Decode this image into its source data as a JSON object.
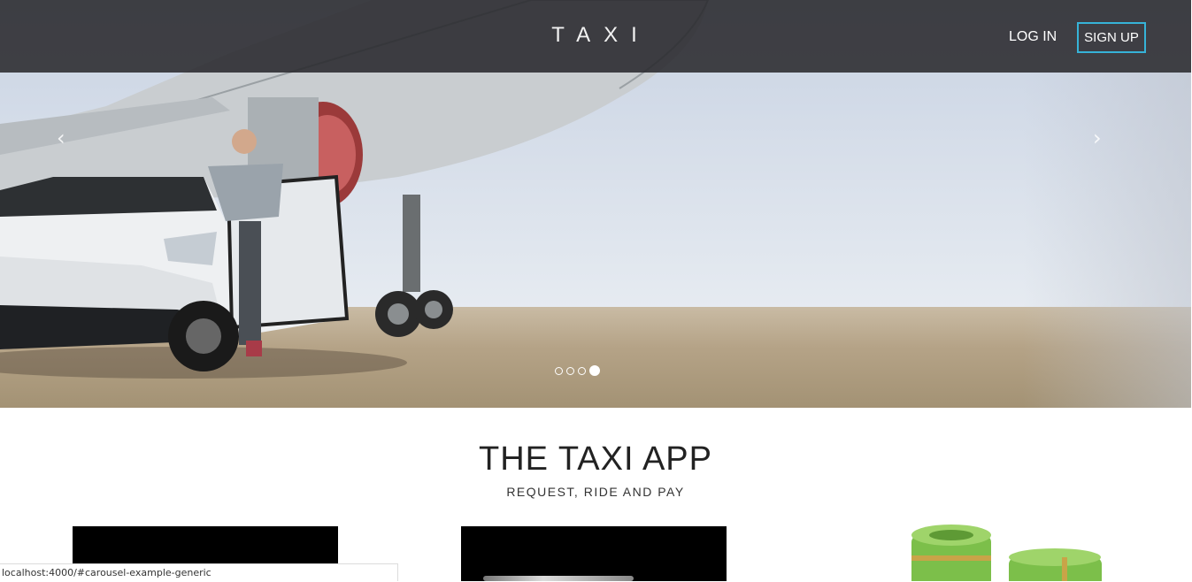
{
  "navbar": {
    "brand": "TAXI",
    "login": "LOG IN",
    "signup": "SIGN UP"
  },
  "carousel": {
    "prev_icon": "chevron-left-icon",
    "next_icon": "chevron-right-icon",
    "prev_glyph": "‹",
    "next_glyph": "›",
    "slide_count": 4,
    "active_slide": 4
  },
  "main": {
    "title": "THE TAXI APP",
    "subtitle": "REQUEST, RIDE AND PAY"
  },
  "statusbar": {
    "url": "localhost:4000/#carousel-example-generic"
  },
  "colors": {
    "navbar_bg": "#28282c",
    "signup_border": "#36b3d8"
  }
}
